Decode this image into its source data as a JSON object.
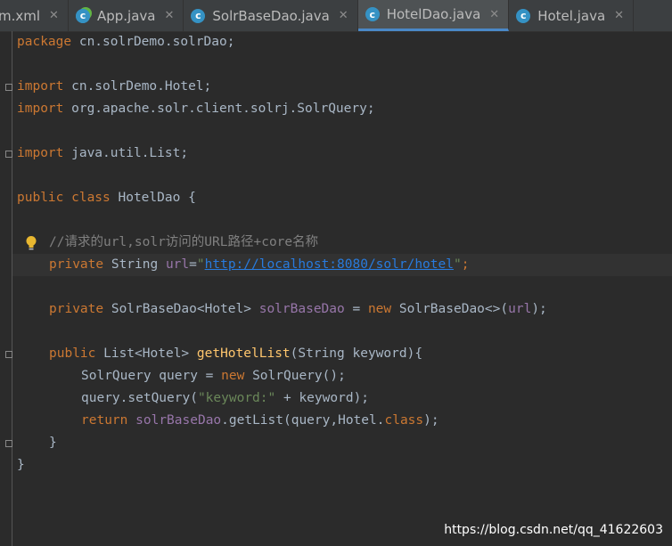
{
  "tabs": [
    {
      "label": "m.xml",
      "icon": "maven-xml-icon"
    },
    {
      "label": "App.java",
      "icon": "java-class-icon"
    },
    {
      "label": "SolrBaseDao.java",
      "icon": "java-class-icon"
    },
    {
      "label": "HotelDao.java",
      "icon": "java-class-icon",
      "active": true
    },
    {
      "label": "Hotel.java",
      "icon": "java-class-icon"
    }
  ],
  "code": {
    "l1_kw": "package",
    "l1_rest": " cn.solrDemo.solrDao;",
    "l3_kw": "import",
    "l3_rest": " cn.solrDemo.Hotel;",
    "l4_kw": "import",
    "l4_rest": " org.apache.solr.client.solrj.SolrQuery;",
    "l6_kw": "import",
    "l6_rest": " java.util.List;",
    "l8_kw": "public class",
    "l8_rest": " HotelDao {",
    "l10_comment": "//请求的url,solr访问的URL路径+core名称",
    "l11_kw": "private",
    "l11_type": " String ",
    "l11_field": "url",
    "l11_eq": "=",
    "l11_q1": "\"",
    "l11_url": "http://localhost:8080/solr/hotel",
    "l11_q2": "\"",
    "l11_end": ";",
    "l13_kw": "private",
    "l13_type": " SolrBaseDao<Hotel> ",
    "l13_field": "solrBaseDao",
    "l13_eq": " = ",
    "l13_new": "new",
    "l13_rest1": " SolrBaseDao<>(",
    "l13_arg": "url",
    "l13_rest2": ");",
    "l15_kw": "public",
    "l15_type": " List<Hotel> ",
    "l15_fn": "getHotelList",
    "l15_rest": "(String keyword){",
    "l16_a": "SolrQuery query = ",
    "l16_new": "new",
    "l16_b": " SolrQuery();",
    "l17_a": "query.setQuery(",
    "l17_str": "\"keyword:\"",
    "l17_b": " + keyword);",
    "l18_kw": "return",
    "l18_sp": " ",
    "l18_field": "solrBaseDao",
    "l18_a": ".getList(query,Hotel.",
    "l18_cls": "class",
    "l18_b": ");",
    "l19": "}",
    "l20": "}"
  },
  "watermark": "https://blog.csdn.net/qq_41622603",
  "colors": {
    "background": "#2b2b2b",
    "keyword": "#cc7832",
    "field": "#9876aa",
    "method": "#ffc66d",
    "string": "#6a8759",
    "comment": "#808080",
    "link": "#287bde"
  }
}
